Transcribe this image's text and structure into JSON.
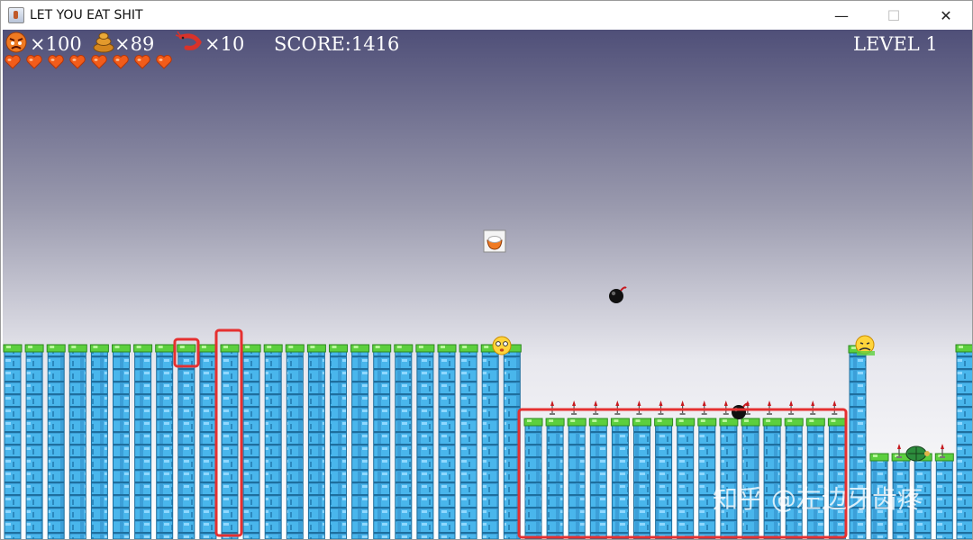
{
  "window": {
    "title": "LET YOU EAT SHIT",
    "minimize": "—",
    "maximize": "☐",
    "close": "✕"
  },
  "hud": {
    "lives_count": "×100",
    "poop_count": "×89",
    "shrimp_count": "×10",
    "score": "SCORE:1416",
    "level": "LEVEL 1",
    "hearts": 8
  },
  "watermark": "知乎 @左边牙齿疼",
  "icons": [
    "angry-face-icon",
    "poop-icon",
    "shrimp-icon",
    "heart-icon",
    "rice-bowl-icon",
    "bomb-icon",
    "smiley-face-icon",
    "sad-face-icon",
    "turtle-shell-icon",
    "spike-icon"
  ],
  "colors": {
    "sky_top": "#4f4f78",
    "sky_bottom": "#ffffff",
    "pillar_blue": "#3aa0dc",
    "pillar_top": "#5ccf3e",
    "highlight_red": "#e53030",
    "heart": "#f25c1a"
  }
}
